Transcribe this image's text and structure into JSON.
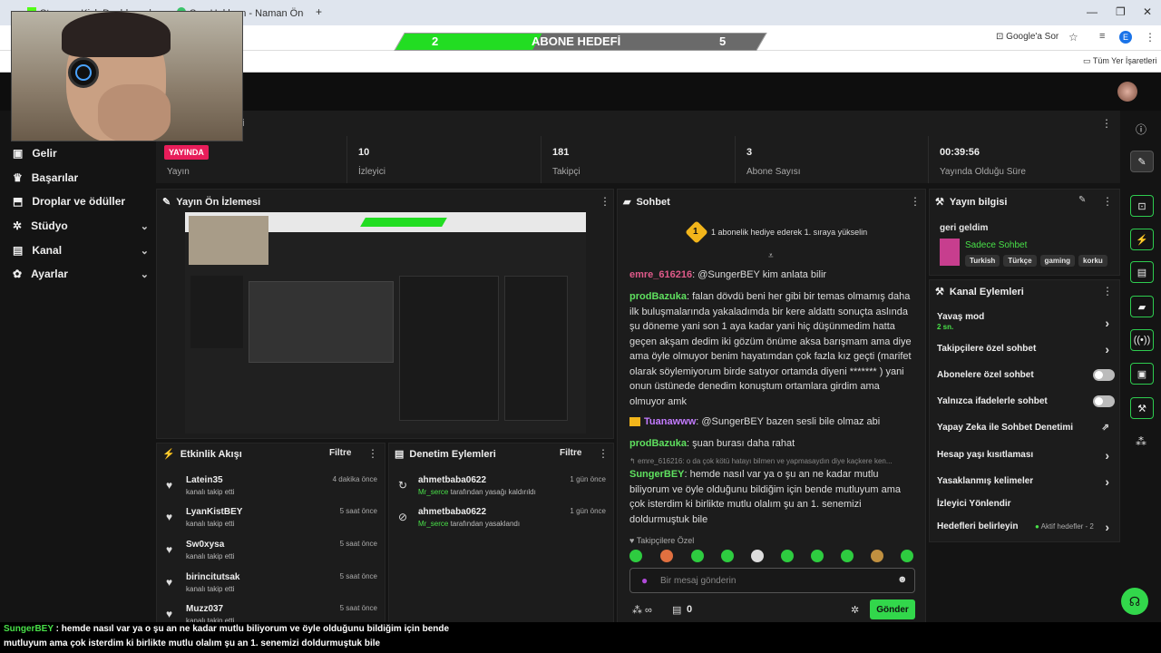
{
  "browser": {
    "tab1": "Stream - Kick Dashboard",
    "tab2": "Sen Haklısın - Naman Öncel",
    "new_tab": "+",
    "search_label": "Google'a Sor",
    "bookmarks_label": "Tüm Yer İşaretleri",
    "profile": "E"
  },
  "goal": {
    "current": "2",
    "title": "ABONE HEDEFİ",
    "target": "5"
  },
  "stats": {
    "live_label": "YAYINDA",
    "live_sub": "Yayın",
    "viewers": "10",
    "viewers_label": "İzleyici",
    "followers": "181",
    "followers_label": "Takipçi",
    "subs": "3",
    "subs_label": "Abone Sayısı",
    "uptime": "00:39:56",
    "uptime_label": "Yayında Olduğu Süre"
  },
  "sidebar": {
    "header_tail": "ri",
    "items": [
      {
        "label": "Gelir",
        "icon": "dollar-icon"
      },
      {
        "label": "Başarılar",
        "icon": "trophy-icon"
      },
      {
        "label": "Droplar ve ödüller",
        "icon": "gift-icon"
      },
      {
        "label": "Stüdyo",
        "icon": "gear-icon"
      },
      {
        "label": "Kanal",
        "icon": "tv-icon"
      },
      {
        "label": "Ayarlar",
        "icon": "settings-icon"
      }
    ]
  },
  "preview": {
    "title": "Yayın Ön İzlemesi"
  },
  "chat": {
    "title": "Sohbet",
    "gift_banner": "1 abonelik hediye ederek 1. sıraya yükselin",
    "gift_count": "1",
    "messages": [
      {
        "user": "emre_616216",
        "color": "#e05a8a",
        "text": ": @SungerBEY kim anlata bilir"
      },
      {
        "user": "prodBazuka",
        "color": "#5fe05f",
        "text": ": falan dövdü beni her gibi bir temas olmamış daha ilk buluşmalarında yakaladımda bir kere aldattı sonuçta aslında şu döneme yani son 1 aya kadar yani hiç düşünmedim hatta geçen akşam dedim iki gözüm önüme aksa barışmam ama diye ama öyle olmuyor benim hayatımdan çok fazla kız geçti (marifet olarak söylemiyorum birde satıyor ortamda diyeni ******* ) yani onun üstünede denedim konuştum ortamlara girdim ama olmuyor amk"
      },
      {
        "user": "Tuanawww",
        "color": "#c37bff",
        "text": ": @SungerBEY bazen sesli bile olmaz abi"
      },
      {
        "user": "prodBazuka",
        "color": "#5fe05f",
        "text": ": şuan burası daha rahat"
      },
      {
        "user": "SungerBEY",
        "color": "#5fe05f",
        "text": ": hemde nasıl var ya o şu an ne kadar mutlu biliyorum ve öyle olduğunu bildiğim için bende mutluyum ama çok isterdim ki birlikte mutlu olalım şu an 1. senemizi doldurmuştuk bile"
      }
    ],
    "reply_preview": "emre_616216: o da çok kötü hatayı bilmen ve yapmasaydın diye kaçkere ken...",
    "followers_only": "Takipçilere Özel",
    "placeholder": "Bir mesaj gönderin",
    "send": "Gönder",
    "points": "0"
  },
  "info": {
    "title": "Yayın bilgisi",
    "stream_title": "geri geldim",
    "category": "Sadece Sohbet",
    "tags": [
      "Turkish",
      "Türkçe",
      "gaming",
      "korku"
    ]
  },
  "actions": {
    "title": "Kanal Eylemleri",
    "slow_mode": "Yavaş mod",
    "slow_value": "2 sn.",
    "items": [
      "Takipçilere özel sohbet",
      "Abonelere özel sohbet",
      "Yalnızca ifadelerle sohbet",
      "Yapay Zeka ile Sohbet Denetimi",
      "Hesap yaşı kısıtlaması",
      "Yasaklanmış kelimeler",
      "İzleyici Yönlendir",
      "Hedefleri belirleyin"
    ],
    "goals_active": "Aktif hedefler - 2"
  },
  "activity": {
    "title": "Etkinlik Akışı",
    "filter": "Filtre",
    "items": [
      {
        "name": "Latein35",
        "sub": "kanalı takip etti",
        "time": "4 dakika önce"
      },
      {
        "name": "LyanKistBEY",
        "sub": "kanalı takip etti",
        "time": "5 saat önce"
      },
      {
        "name": "Sw0xysa",
        "sub": "kanalı takip etti",
        "time": "5 saat önce"
      },
      {
        "name": "birincitutsak",
        "sub": "kanalı takip etti",
        "time": "5 saat önce"
      },
      {
        "name": "Muzz037",
        "sub": "kanalı takip etti",
        "time": "5 saat önce"
      }
    ]
  },
  "moderation": {
    "title": "Denetim Eylemleri",
    "filter": "Filtre",
    "items": [
      {
        "name": "ahmetbaba0622",
        "by": "Mr_serce",
        "sub": " tarafından yasağı kaldırıldı",
        "time": "1 gün önce"
      },
      {
        "name": "ahmetbaba0622",
        "by": "Mr_serce",
        "sub": " tarafından yasaklandı",
        "time": "1 gün önce"
      }
    ]
  },
  "subtitle": {
    "user": "SungerBEY",
    "line1": " : hemde nasıl var ya o şu an ne kadar mutlu biliyorum ve öyle olduğunu bildiğim için bende",
    "line2": "mutluyum ama çok isterdim ki birlikte mutlu olalım şu an 1. senemizi doldurmuştuk bile"
  }
}
